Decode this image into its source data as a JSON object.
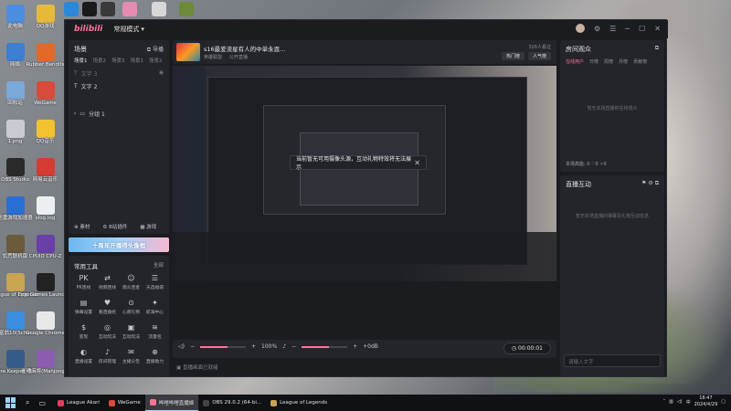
{
  "desktop": {
    "icons": [
      {
        "label": "此电脑",
        "color": "#4a8ee0"
      },
      {
        "label": "QQ游戏",
        "color": "#e6b93a"
      },
      {
        "label": "网络",
        "color": "#3d7fd0"
      },
      {
        "label": "Rubber Bandits",
        "color": "#e06a2a"
      },
      {
        "label": "回收站",
        "color": "#7aa8d8"
      },
      {
        "label": "WeGame",
        "color": "#d84b3c"
      },
      {
        "label": "1.png",
        "color": "#c9cdd3"
      },
      {
        "label": "QQ音乐",
        "color": "#f2c230"
      },
      {
        "label": "OBS Studio",
        "color": "#2a2a2a"
      },
      {
        "label": "网易云音乐",
        "color": "#d43c33"
      },
      {
        "label": "迅雷游戏加速器",
        "color": "#2a6fd6"
      },
      {
        "label": "slog.log",
        "color": "#eceff2"
      },
      {
        "label": "饥荒联机版",
        "color": "#6b5a3c"
      },
      {
        "label": "CPUID CPU-Z",
        "color": "#6a3fa8"
      },
      {
        "label": "League of Legends",
        "color": "#c8a350"
      },
      {
        "label": "Epic Games Launcher",
        "color": "#222222"
      },
      {
        "label": "大富翁10(Schin...",
        "color": "#3b8de0"
      },
      {
        "label": "Google Chrome",
        "color": "#e8e8e8"
      },
      {
        "label": "Core Keeper 地...",
        "color": "#365c8a"
      },
      {
        "label": "雀魂麻将(Mahjong...",
        "color": "#8b5db0"
      }
    ]
  },
  "window": {
    "logo": "bilibili",
    "mode": "常规模式",
    "controls": {
      "minimize": "─",
      "maximize": "☐",
      "close": "✕"
    }
  },
  "scenes": {
    "title": "场景",
    "guide": "导播",
    "tabs": [
      "场景1",
      "场景2",
      "场景3",
      "场景1",
      "场景2"
    ],
    "sources": [
      {
        "label": "文字 3",
        "dim": true
      },
      {
        "label": "文字 2",
        "dim": false
      },
      {
        "label": "分组 1",
        "dim": false
      }
    ],
    "footer": [
      "素材",
      "B站插件",
      "游戏"
    ]
  },
  "banner": {
    "text": "十周年开播得头像框"
  },
  "tools": {
    "title": "常用工具",
    "all": "全部",
    "items": [
      {
        "icon": "PK",
        "label": "PK连线"
      },
      {
        "icon": "⇄",
        "label": "视频连线"
      },
      {
        "icon": "☺",
        "label": "观众连麦"
      },
      {
        "icon": "☰",
        "label": "天选福袋"
      },
      {
        "icon": "▤",
        "label": "弹幕设置"
      },
      {
        "icon": "♥",
        "label": "看直播抢"
      },
      {
        "icon": "⊙",
        "label": "心愿礼物"
      },
      {
        "icon": "✦",
        "label": "航海中心"
      },
      {
        "icon": "$",
        "label": "变现"
      },
      {
        "icon": "◎",
        "label": "互动玩法"
      },
      {
        "icon": "▣",
        "label": "互动玩法"
      },
      {
        "icon": "≋",
        "label": "流量包"
      },
      {
        "icon": "◐",
        "label": "直播设置"
      },
      {
        "icon": "♪",
        "label": "房间管理"
      },
      {
        "icon": "✉",
        "label": "主播公告"
      },
      {
        "icon": "⊕",
        "label": "直播助力"
      }
    ]
  },
  "room": {
    "title": "s16最爱流星有人的中单永恩...",
    "category": "英雄联盟",
    "visibility": "公开直播",
    "viewers": "326人看过",
    "button1": "热门榜",
    "button2": "人气榜"
  },
  "toast": {
    "text": "当前暂无可用摄像头源，互动礼物特效将无法展示",
    "close": "✕"
  },
  "controls": {
    "volume1": "100%",
    "volume2": "+0dB",
    "timer": "00:00:01",
    "slider_fill_fraction": 0.6
  },
  "status": {
    "text": "直播画面已就绪"
  },
  "audience": {
    "title": "房间观众",
    "tabs": [
      "在线用户",
      "日榜",
      "周榜",
      "月榜",
      "贡献榜"
    ],
    "empty": "暂无本场直播的在线观众",
    "count_label": "本场高能:",
    "count_values": [
      "0",
      "0",
      "0"
    ]
  },
  "live": {
    "title": "直播互动",
    "empty": "暂无本场直播的弹幕及礼物互动信息",
    "input_placeholder": "请输入文字"
  },
  "taskbar": {
    "tasks": [
      {
        "label": "League Akari",
        "color": "#e04060",
        "active": false
      },
      {
        "label": "WeGame",
        "color": "#d84b3c",
        "active": false
      },
      {
        "label": "哔哩哔哩直播姬",
        "color": "#fb7299",
        "active": true
      },
      {
        "label": "OBS 29.0.2 (64-bi...",
        "color": "#444444",
        "active": false
      },
      {
        "label": "League of Legends",
        "color": "#c8a350",
        "active": false
      }
    ],
    "ime": "中",
    "time": "18:47",
    "date": "2024/4/29"
  }
}
